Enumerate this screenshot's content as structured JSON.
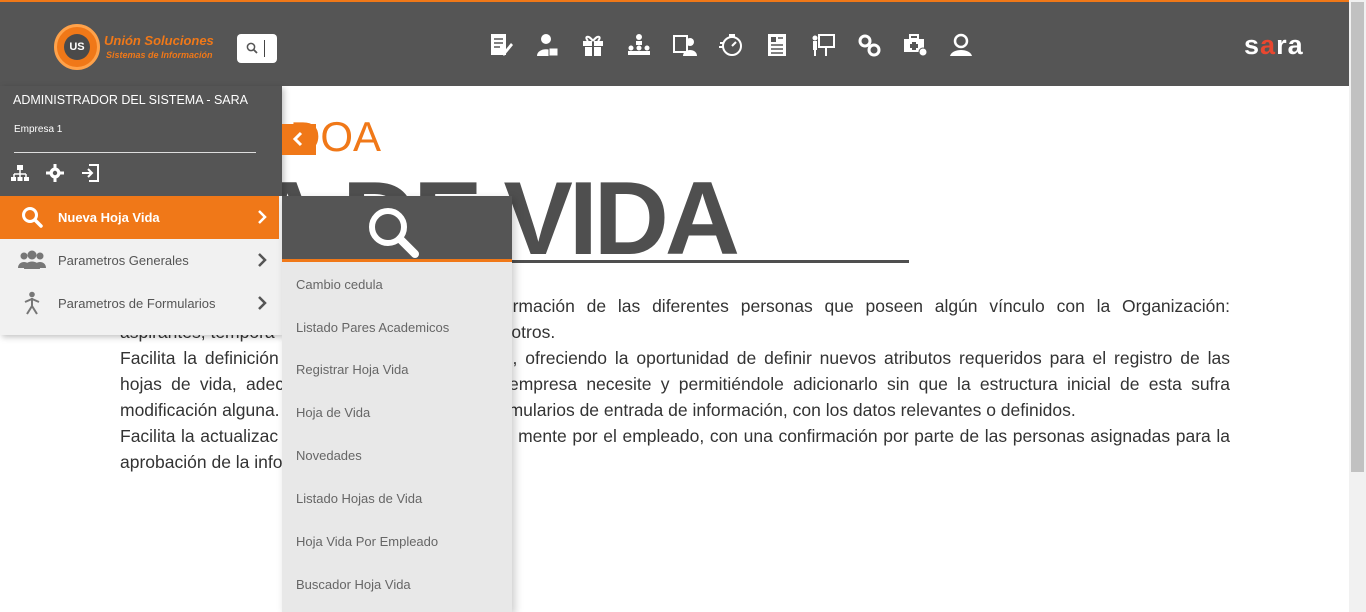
{
  "topbar": {
    "logo": {
      "badge": "US",
      "name": "Unión Soluciones",
      "tagline": "Sistemas de Información"
    },
    "brand": {
      "prefix": "s",
      "accent": "a",
      "suffix": "ra"
    },
    "module_icons": [
      "resume-edit-icon",
      "user-badge-icon",
      "gift-icon",
      "org-chart-icon",
      "user-card-icon",
      "stopwatch-icon",
      "document-list-icon",
      "presentation-icon",
      "gears-icon",
      "medical-case-icon",
      "person-search-icon"
    ]
  },
  "sidebar": {
    "user": "ADMINISTRADOR DEL SISTEMA - SARA",
    "company": "Empresa 1",
    "actions": [
      "sitemap-icon",
      "settings-icon",
      "logout-icon"
    ],
    "items": [
      {
        "label": "Nueva Hoja Vida",
        "icon": "search-icon",
        "active": true
      },
      {
        "label": "Parametros Generales",
        "icon": "users-group-icon",
        "active": false
      },
      {
        "label": "Parametros de Formularios",
        "icon": "person-icon",
        "active": false
      }
    ]
  },
  "flyout": {
    "icon": "search-icon",
    "items": [
      "Cambio cedula",
      "Listado Pares Academicos",
      "Registrar Hoja Vida",
      "Hoja de Vida",
      "Novedades",
      "Listado Hojas de Vida",
      "Hoja Vida Por Empleado",
      "Buscador Hoja Vida"
    ]
  },
  "main": {
    "subtitle": "DOA",
    "title": "A DE VIDA",
    "paragraphs": [
      "formación de las diferentes personas que poseen algún vínculo con la Organización:",
      "aspirantes, tempora",
      "entre otros.",
      "Facilita la definición",
      "s, ofreciendo la oportunidad de definir nuevos atributos requeridos para el registro de las",
      "hojas de vida, adec",
      "empresa necesite y permitiéndole adicionarlo sin que la estructura inicial de esta sufra",
      "modificación alguna.",
      "s formularios de entrada de información, con los datos relevantes o definidos.",
      "Facilita la actualizac",
      "mente por el empleado, con una confirmación por parte de las personas asignadas para la",
      "aprobación de la info"
    ]
  },
  "colors": {
    "accent": "#f07818",
    "bar": "#555555",
    "brand_red": "#e9472f"
  }
}
